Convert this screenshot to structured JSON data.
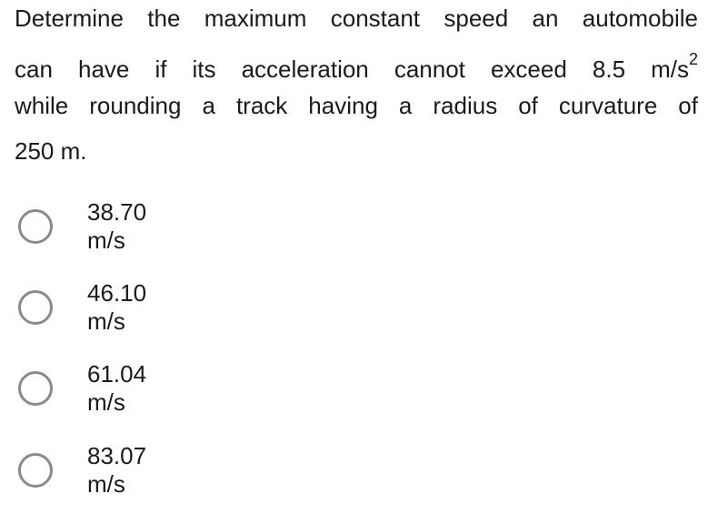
{
  "question": {
    "lines": [
      "Determine the maximum constant speed an automobile",
      "can have if its acceleration cannot exceed 8.5 m/s",
      "while rounding a track having a radius of curvature of",
      "250 m."
    ],
    "superscript": "2"
  },
  "options": [
    {
      "label": "38.70 m/s",
      "selected": false
    },
    {
      "label": "46.10 m/s",
      "selected": false
    },
    {
      "label": "61.04 m/s",
      "selected": false
    },
    {
      "label": "83.07 m/s",
      "selected": false
    }
  ]
}
